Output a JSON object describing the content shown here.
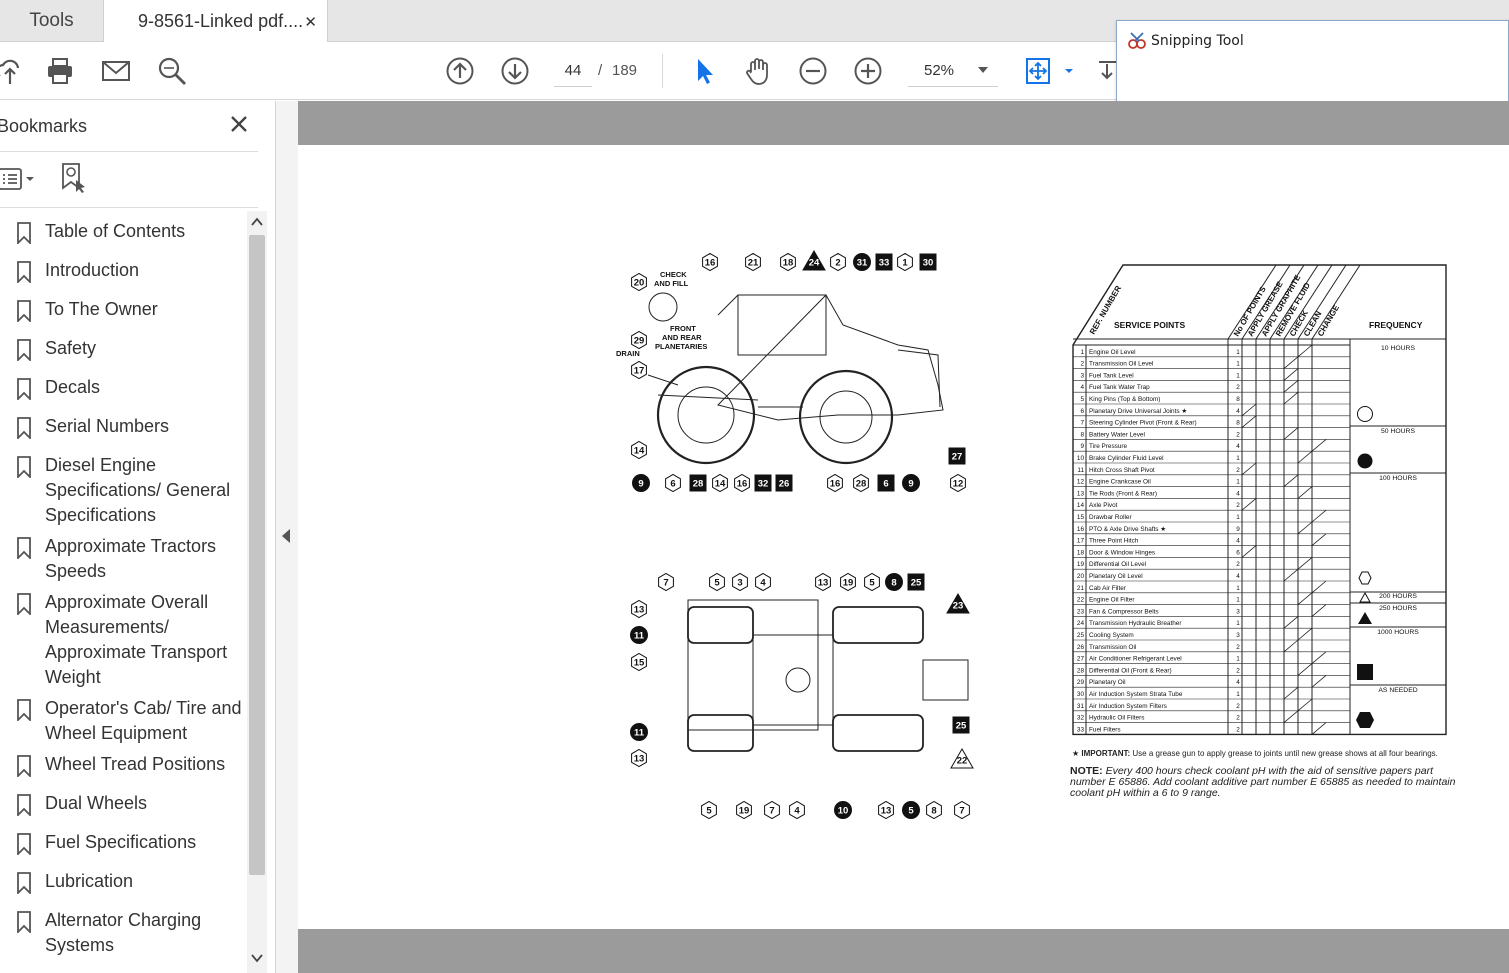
{
  "tabs": {
    "tools": "Tools",
    "document": "9-8561-Linked pdf....",
    "close": "✕"
  },
  "toolbar": {
    "page_current": "44",
    "page_sep": "/",
    "page_total": "189",
    "zoom": "52%"
  },
  "snipping_tool": {
    "title": "Snipping Tool"
  },
  "bookmarks": {
    "title": "Bookmarks",
    "items": [
      "Table of Contents",
      "Introduction",
      "To The Owner",
      "Safety",
      "Decals",
      "Serial Numbers",
      "Diesel Engine Specifications/ General Specifications",
      "Approximate Tractors Speeds",
      "Approximate Overall Measurements/ Approximate Transport Weight",
      "Operator's Cab/ Tire and Wheel Equipment",
      "Wheel Tread Positions",
      "Dual Wheels",
      "Fuel Specifications",
      "Lubrication",
      "Alternator Charging Systems"
    ]
  },
  "diagram": {
    "check_and_fill": [
      "CHECK",
      "AND FILL"
    ],
    "front_rear_planetaries": [
      "FRONT",
      "AND REAR",
      "PLANETARIES"
    ],
    "drain": "DRAIN",
    "side_labels": [
      "16",
      "21",
      "18",
      "24",
      "2",
      "31",
      "33",
      "1",
      "30",
      "20",
      "29",
      "17",
      "14",
      "9",
      "6",
      "28",
      "14",
      "16",
      "32",
      "26",
      "16",
      "28",
      "6",
      "9",
      "12",
      "27"
    ],
    "top_labels": [
      "7",
      "5",
      "3",
      "4",
      "13",
      "19",
      "5",
      "8",
      "25",
      "23",
      "13",
      "11",
      "15",
      "11",
      "13",
      "25",
      "22",
      "5",
      "19",
      "7",
      "4",
      "10",
      "13",
      "5",
      "8",
      "7"
    ]
  },
  "chart": {
    "headers": {
      "ref_number": "REF. NUMBER",
      "service_points": "SERVICE POINTS",
      "columns": [
        "No OF POINTS",
        "APPLY GREASE",
        "APPLY GRAPHITE",
        "REMOVE FLUID",
        "CHECK",
        "CLEAN",
        "CHANGE"
      ],
      "frequency": "FREQUENCY"
    },
    "rows": [
      [
        "1",
        "Engine Oil Level",
        "1"
      ],
      [
        "2",
        "Transmission Oil Level",
        "1"
      ],
      [
        "3",
        "Fuel Tank Level",
        "1"
      ],
      [
        "4",
        "Fuel Tank Water Trap",
        "2"
      ],
      [
        "5",
        "King Pins (Top & Bottom)",
        "8"
      ],
      [
        "6",
        "Planetary Drive Universal Joints ★",
        "4"
      ],
      [
        "7",
        "Steering Cylinder Pivot (Front & Rear)",
        "8"
      ],
      [
        "8",
        "Battery Water Level",
        "2"
      ],
      [
        "9",
        "Tire Pressure",
        "4"
      ],
      [
        "10",
        "Brake Cylinder Fluid Level",
        "1"
      ],
      [
        "11",
        "Hitch Cross Shaft Pivot",
        "2"
      ],
      [
        "12",
        "Engine Crankcase Oil",
        "1"
      ],
      [
        "13",
        "Tie Rods (Front & Rear)",
        "4"
      ],
      [
        "14",
        "Axle Pivot",
        "2"
      ],
      [
        "15",
        "Drawbar Roller",
        "1"
      ],
      [
        "16",
        "PTO & Axle Drive Shafts ★",
        "9"
      ],
      [
        "17",
        "Three Point Hitch",
        "4"
      ],
      [
        "18",
        "Door & Window Hinges",
        "6"
      ],
      [
        "19",
        "Differential Oil Level",
        "2"
      ],
      [
        "20",
        "Planetary Oil Level",
        "4"
      ],
      [
        "21",
        "Cab Air Filter",
        "1"
      ],
      [
        "22",
        "Engine Oil Filter",
        "1"
      ],
      [
        "23",
        "Fan & Compressor Belts",
        "3"
      ],
      [
        "24",
        "Transmission Hydraulic Breather",
        "1"
      ],
      [
        "25",
        "Cooling System",
        "3"
      ],
      [
        "26",
        "Transmission Oil",
        "2"
      ],
      [
        "27",
        "Air Conditioner Refrigerant Level",
        "1"
      ],
      [
        "28",
        "Differential Oil (Front & Rear)",
        "2"
      ],
      [
        "29",
        "Planetary Oil",
        "4"
      ],
      [
        "30",
        "Air Induction System Strata Tube",
        "1"
      ],
      [
        "31",
        "Air Induction System Filters",
        "2"
      ],
      [
        "32",
        "Hydraulic Oil Filters",
        "2"
      ],
      [
        "33",
        "Fuel Filters",
        "2"
      ]
    ],
    "frequencies": [
      "10 HOURS",
      "50 HOURS",
      "100 HOURS",
      "200 HOURS",
      "250 HOURS",
      "1000 HOURS",
      "AS NEEDED"
    ]
  },
  "notes": {
    "important_label": "★ IMPORTANT:",
    "important_text": "Use a grease gun to apply grease to joints until new grease shows at all four bearings.",
    "note_label": "NOTE:",
    "note_text": "Every 400 hours check coolant pH with the aid of sensitive papers part number E 65886. Add coolant additive part number E 65885 as needed to maintain coolant pH within a 6 to 9 range."
  }
}
